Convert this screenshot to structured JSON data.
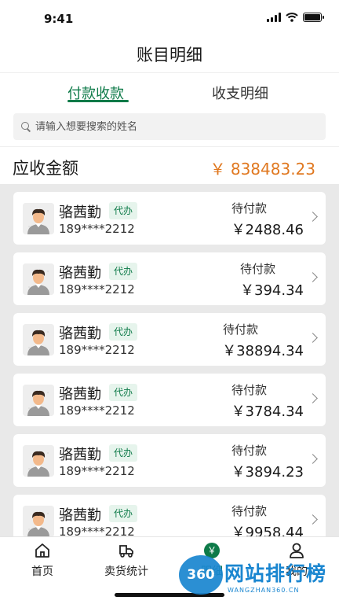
{
  "status_bar": {
    "time": "9:41"
  },
  "header": {
    "title": "账目明细"
  },
  "tabs": [
    {
      "label": "付款收款",
      "active": true
    },
    {
      "label": "收支明细",
      "active": false
    }
  ],
  "search": {
    "placeholder": "请输入想要搜索的姓名"
  },
  "summary": {
    "label": "应收金额",
    "amount": "￥ 838483.23"
  },
  "records": [
    {
      "name": "骆茜勤",
      "badge": "代办",
      "phone": "189****2212",
      "status": "待付款",
      "amount": "￥2488.46"
    },
    {
      "name": "骆茜勤",
      "badge": "代办",
      "phone": "189****2212",
      "status": "待付款",
      "amount": "￥394.34"
    },
    {
      "name": "骆茜勤",
      "badge": "代办",
      "phone": "189****2212",
      "status": "待付款",
      "amount": "￥38894.34"
    },
    {
      "name": "骆茜勤",
      "badge": "代办",
      "phone": "189****2212",
      "status": "待付款",
      "amount": "￥3784.34"
    },
    {
      "name": "骆茜勤",
      "badge": "代办",
      "phone": "189****2212",
      "status": "待付款",
      "amount": "￥3894.23"
    },
    {
      "name": "骆茜勤",
      "badge": "代办",
      "phone": "189****2212",
      "status": "待付款",
      "amount": "￥9958.44"
    }
  ],
  "tabbar": {
    "items": [
      {
        "label": "首页",
        "icon": "home-icon"
      },
      {
        "label": "卖货统计",
        "icon": "delivery-truck-icon"
      },
      {
        "label": "明细",
        "icon": "yen-circle-icon",
        "glyph": "￥",
        "active": true
      },
      {
        "label": "我的",
        "icon": "user-icon"
      }
    ]
  },
  "watermark": {
    "logo": "360",
    "title": "网站排行榜",
    "subtitle": "WANGZHAN360.CN"
  },
  "colors": {
    "accent": "#0d7a48",
    "amount": "#e07820",
    "list_bg": "#e9e9e9"
  }
}
